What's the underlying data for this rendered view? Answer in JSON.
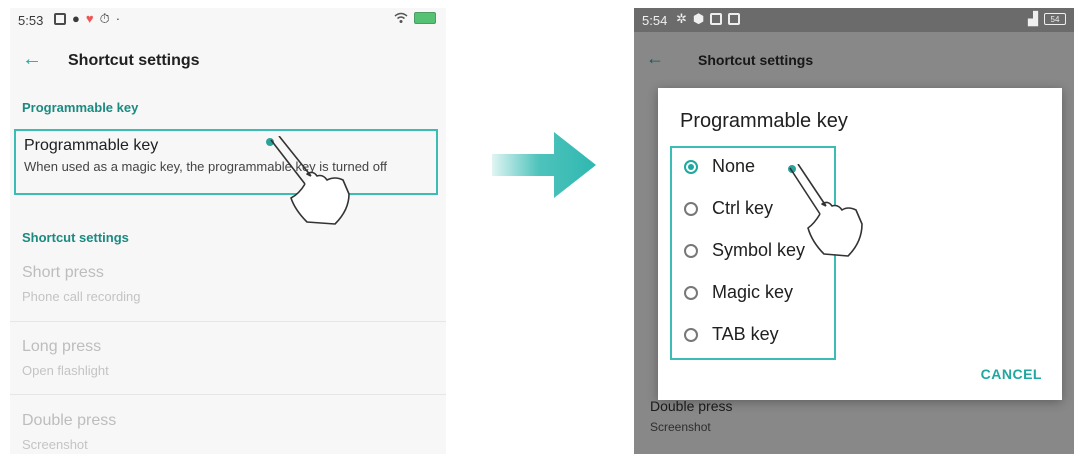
{
  "colors": {
    "accent": "#1ea8a0",
    "highlight": "#3bbdb5",
    "arrow": "#2fb8b0"
  },
  "left": {
    "status": {
      "time": "5:53"
    },
    "appbar": {
      "back_icon": "arrow-left-icon",
      "title": "Shortcut settings"
    },
    "section1": "Programmable key",
    "highlight_item": {
      "title": "Programmable key",
      "subtitle": "When used as a magic key, the programmable key is turned off"
    },
    "section2": "Shortcut settings",
    "items": [
      {
        "title": "Short press",
        "subtitle": "Phone call recording"
      },
      {
        "title": "Long press",
        "subtitle": "Open flashlight"
      },
      {
        "title": "Double press",
        "subtitle": "Screenshot"
      }
    ]
  },
  "right": {
    "status": {
      "time": "5:54",
      "battery": "54"
    },
    "background": {
      "title": "Shortcut settings",
      "peek_item_title": "Double press",
      "peek_item_subtitle": "Screenshot"
    },
    "dialog": {
      "title": "Programmable key",
      "options": [
        "None",
        "Ctrl key",
        "Symbol key",
        "Magic key",
        "TAB key"
      ],
      "selected": "None",
      "cancel_label": "CANCEL"
    }
  }
}
